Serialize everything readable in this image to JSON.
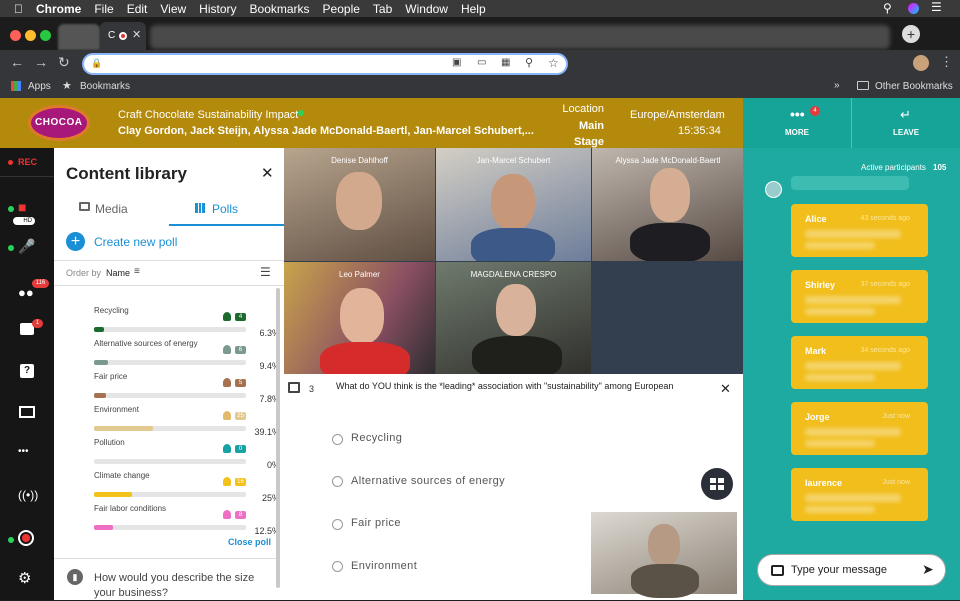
{
  "menubar": {
    "app": "Chrome",
    "items": [
      "File",
      "Edit",
      "View",
      "History",
      "Bookmarks",
      "People",
      "Tab",
      "Window",
      "Help"
    ]
  },
  "tab": {
    "letter": "C"
  },
  "bookmarks": {
    "apps": "Apps",
    "bookmarks": "Bookmarks",
    "other": "Other Bookmarks"
  },
  "header": {
    "logo": "CHOCOA",
    "title": "Craft Chocolate Sustainability Impact",
    "speakers": "Clay Gordon, Jack Steijn, Alyssa Jade McDonald-Baertl, Jan-Marcel Schubert,...",
    "location_label": "Location",
    "location_value": "Main Stage",
    "timezone": "Europe/Amsterdam",
    "time": "15:35:34"
  },
  "actions": {
    "more": "MORE",
    "more_badge": "4",
    "leave": "LEAVE"
  },
  "rail": {
    "rec": "REC",
    "hd": "HD",
    "participants_badge": "116",
    "chat_badge": "1"
  },
  "library": {
    "title": "Content library",
    "tab_media": "Media",
    "tab_polls": "Polls",
    "create": "Create new poll",
    "order_by": "Order by",
    "order_value": "Name",
    "close_poll": "Close poll",
    "next_poll": "How would you describe the size your business?",
    "results": [
      {
        "label": "Recycling",
        "count": "4",
        "pct": "6.3%",
        "value": 6.3,
        "color": "#1b6b2f",
        "user_color": "#1b6b2f"
      },
      {
        "label": "Alternative sources of energy",
        "count": "6",
        "pct": "9.4%",
        "value": 9.4,
        "color": "#7a9a8e",
        "user_color": "#7a9a8e"
      },
      {
        "label": "Fair price",
        "count": "5",
        "pct": "7.8%",
        "value": 7.8,
        "color": "#a5714f",
        "user_color": "#a5714f"
      },
      {
        "label": "Environment",
        "count": "25",
        "pct": "39.1%",
        "value": 39.1,
        "color": "#e2c98f",
        "user_color": "#e2b96a"
      },
      {
        "label": "Pollution",
        "count": "0",
        "pct": "0%",
        "value": 0,
        "color": "#17a3a3",
        "user_color": "#17a3a3"
      },
      {
        "label": "Climate change",
        "count": "16",
        "pct": "25%",
        "value": 25,
        "color": "#f2c21a",
        "user_color": "#f2c21a"
      },
      {
        "label": "Fair labor conditions",
        "count": "8",
        "pct": "12.5%",
        "value": 12.5,
        "color": "#ee6fc4",
        "user_color": "#ee6fc4"
      }
    ]
  },
  "videos": {
    "names": [
      "Denise Dahlhoff",
      "Jan-Marcel Schubert",
      "Alyssa Jade McDonald-Baertl",
      "Leo Palmer",
      "MAGDALENA CRESPO"
    ]
  },
  "poll": {
    "number": "3",
    "question": "What do YOU think is the *leading* association with \"sustainability\" among European",
    "options": [
      "Recycling",
      "Alternative sources of energy",
      "Fair price",
      "Environment"
    ]
  },
  "chat": {
    "active_label": "Active participants",
    "active_count": "105",
    "messages": [
      {
        "name": "Alice",
        "time": "43 seconds ago"
      },
      {
        "name": "Shirley",
        "time": "37 seconds ago"
      },
      {
        "name": "Mark",
        "time": "34 seconds ago"
      },
      {
        "name": "Jorge",
        "time": "Just now"
      },
      {
        "name": "laurence",
        "time": "Just now"
      }
    ],
    "input_placeholder": "Type your message"
  }
}
